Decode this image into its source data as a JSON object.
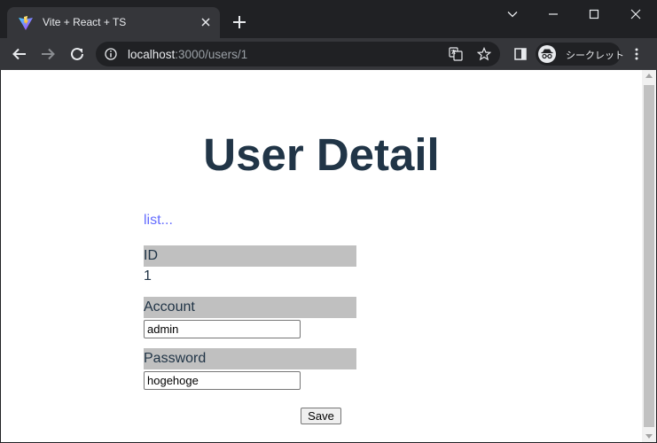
{
  "browser": {
    "tab": {
      "title": "Vite + React + TS",
      "favicon": "vite-logo-icon"
    },
    "url": {
      "host": "localhost",
      "path": ":3000/users/1"
    },
    "profile": {
      "label": "シークレット"
    }
  },
  "page": {
    "title": "User Detail",
    "list_link": "list...",
    "fields": {
      "id": {
        "label": "ID",
        "value": "1"
      },
      "account": {
        "label": "Account",
        "value": "admin"
      },
      "password": {
        "label": "Password",
        "value": "hogehoge"
      }
    },
    "save_label": "Save"
  },
  "colors": {
    "heading": "#213547",
    "link": "#646cff",
    "label_bg": "#c0c0c0",
    "chrome_dark": "#202124",
    "chrome_toolbar": "#35363a"
  }
}
